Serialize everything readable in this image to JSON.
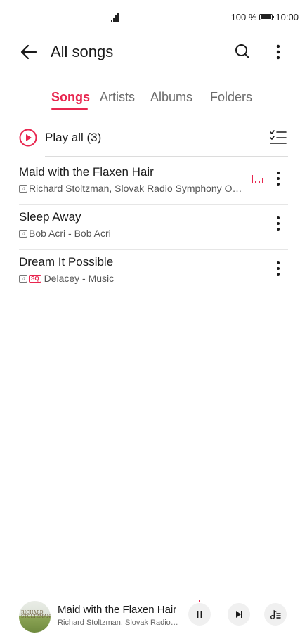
{
  "status_bar": {
    "battery_text": "100 %",
    "time": "10:00",
    "battery_level": 1.0
  },
  "header": {
    "title": "All songs"
  },
  "tabs": [
    {
      "label": "Songs",
      "active": true
    },
    {
      "label": "Artists",
      "active": false
    },
    {
      "label": "Albums",
      "active": false
    },
    {
      "label": "Folders",
      "active": false
    }
  ],
  "play_all": {
    "label": "Play all (3)"
  },
  "songs": [
    {
      "title": "Maid with the Flaxen Hair",
      "subtitle": "Richard Stoltzman, Slovak Radio Symphony O…",
      "playing": true,
      "sq": false
    },
    {
      "title": "Sleep Away",
      "subtitle": "Bob Acri - Bob Acri",
      "playing": false,
      "sq": false
    },
    {
      "title": "Dream It Possible",
      "subtitle": "Delacey - Music",
      "playing": false,
      "sq": true,
      "sq_label": "SQ"
    }
  ],
  "player": {
    "title": "Maid with the Flaxen Hair",
    "subtitle": "Richard Stoltzman, Slovak Radio…",
    "art_text": "RICHARD STOLTZMAN"
  },
  "colors": {
    "accent": "#e8264f",
    "text": "#1a1a1a",
    "secondary": "#555555"
  },
  "icons": [
    "back-arrow-icon",
    "search-icon",
    "more-vertical-icon",
    "play-circle-icon",
    "multi-select-icon",
    "note-icon",
    "equalizer-icon",
    "pause-icon",
    "skip-next-icon",
    "queue-icon",
    "signal-icon",
    "battery-icon"
  ]
}
